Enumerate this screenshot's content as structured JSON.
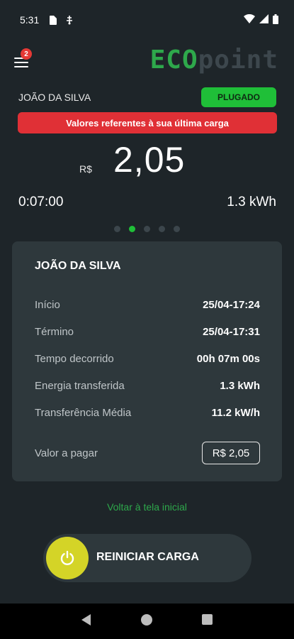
{
  "status_bar": {
    "time": "5:31",
    "icons": [
      "sim-card-icon",
      "usb-icon",
      "wifi-icon",
      "signal-icon",
      "battery-icon"
    ]
  },
  "header": {
    "notification_count": "2",
    "logo_eco": "ECO",
    "logo_point": "point"
  },
  "summary": {
    "user_name": "JOÃO DA SILVA",
    "status": "PLUGADO",
    "warning": "Valores referentes à sua última carga",
    "currency": "R$",
    "amount": "2,05",
    "duration": "0:07:00",
    "energy": "1.3 kWh"
  },
  "pager": {
    "count": 5,
    "active_index": 1
  },
  "details": {
    "title": "JOÃO DA SILVA",
    "rows": [
      {
        "label": "Início",
        "value": "25/04-17:24"
      },
      {
        "label": "Término",
        "value": "25/04-17:31"
      },
      {
        "label": "Tempo decorrido",
        "value": "00h 07m 00s"
      },
      {
        "label": "Energia transferida",
        "value": "1.3 kWh"
      },
      {
        "label": "Transferência Média",
        "value": "11.2 kW/h"
      }
    ],
    "pay_label": "Valor a pagar",
    "pay_value": "R$ 2,05"
  },
  "actions": {
    "back_link": "Voltar à tela inicial",
    "restart_label": "REINICIAR CARGA"
  },
  "colors": {
    "background": "#1e2529",
    "card": "#2e383c",
    "accent_green": "#1fbf38",
    "warning_red": "#e03036",
    "power_yellow": "#d4d427"
  }
}
